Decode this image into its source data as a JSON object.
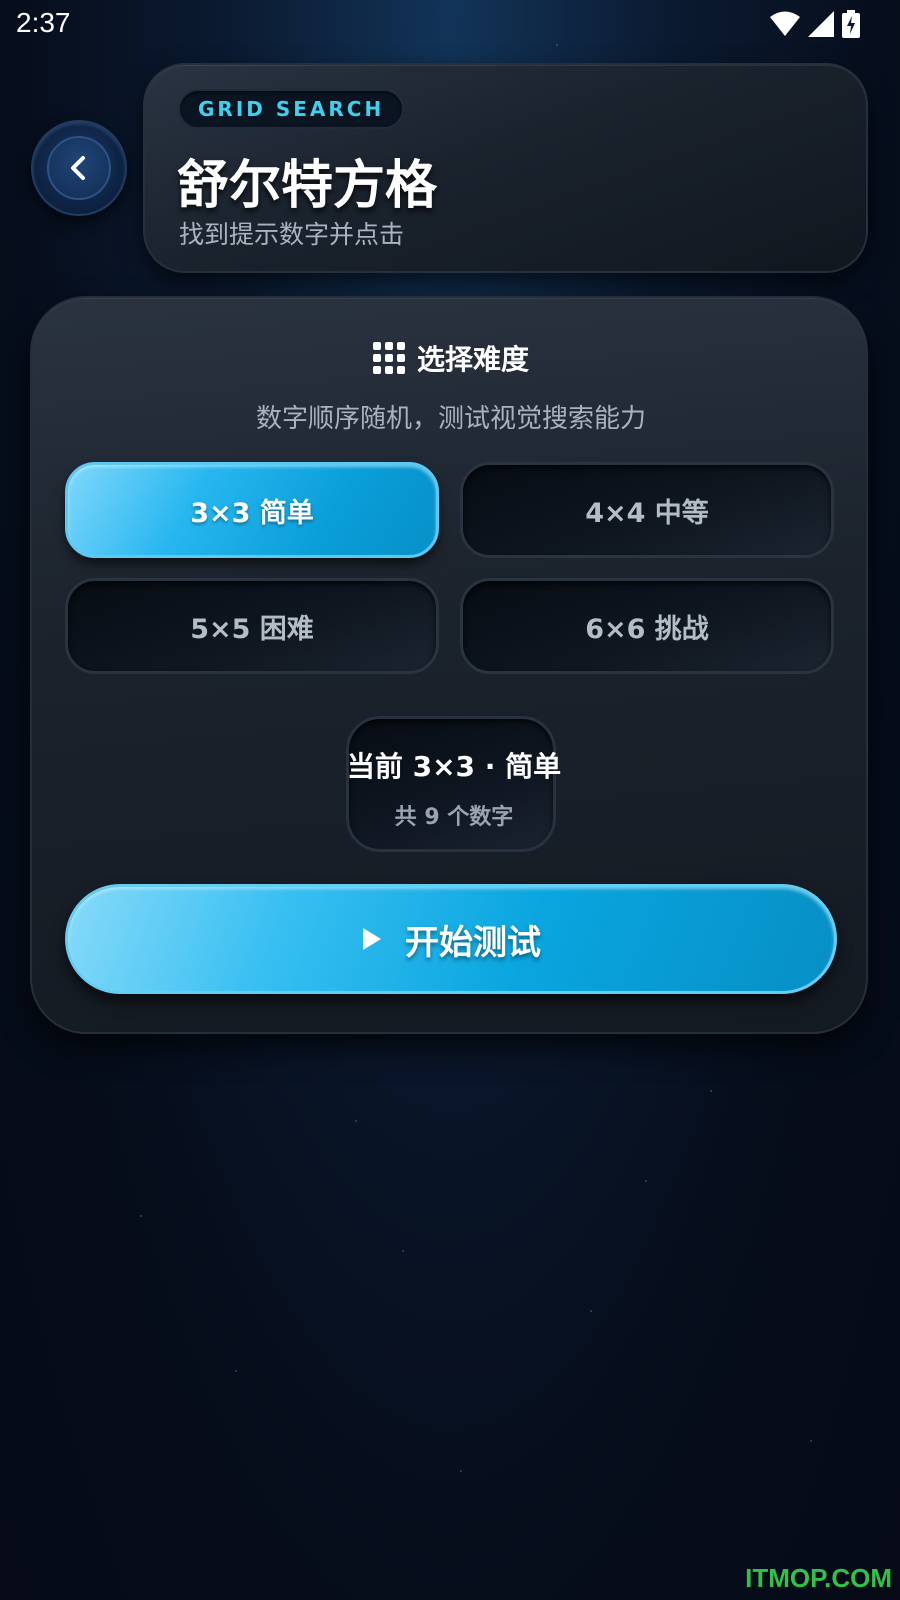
{
  "status_bar": {
    "time": "2:37",
    "icons": [
      "wifi-icon",
      "signal-icon",
      "battery-charging-icon"
    ]
  },
  "header": {
    "tag": "GRID SEARCH",
    "title": "舒尔特方格",
    "subtitle": "找到提示数字并点击",
    "back_icon": "chevron-left-icon"
  },
  "difficulty": {
    "heading": "选择难度",
    "description": "数字顺序随机，测试视觉搜索能力",
    "options": [
      {
        "label": "3×3 简单",
        "selected": true
      },
      {
        "label": "4×4 中等",
        "selected": false
      },
      {
        "label": "5×5 困难",
        "selected": false
      },
      {
        "label": "6×6 挑战",
        "selected": false
      }
    ],
    "current_label": "当前 3×3 · 简单",
    "current_count": "共 9 个数字"
  },
  "start_button": {
    "label": "开始测试",
    "icon": "play-icon"
  },
  "watermark": "ITMOP.COM",
  "colors": {
    "accent": "#0aa5df",
    "tag_text": "#3fd0f0",
    "watermark": "#2fc24a"
  }
}
